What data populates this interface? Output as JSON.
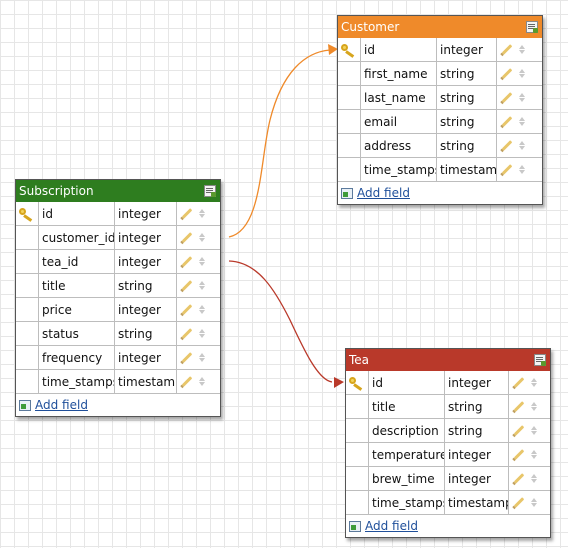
{
  "tables": {
    "customer": {
      "title": "Customer",
      "color": "#ef8a2a",
      "add_label": "Add field",
      "fields": [
        {
          "name": "id",
          "type": "integer",
          "key": true
        },
        {
          "name": "first_name",
          "type": "string"
        },
        {
          "name": "last_name",
          "type": "string"
        },
        {
          "name": "email",
          "type": "string"
        },
        {
          "name": "address",
          "type": "string"
        },
        {
          "name": "time_stamps",
          "type": "timestamp"
        }
      ]
    },
    "subscription": {
      "title": "Subscription",
      "color": "#2e7d1f",
      "add_label": "Add field",
      "fields": [
        {
          "name": "id",
          "type": "integer",
          "key": true
        },
        {
          "name": "customer_id",
          "type": "integer"
        },
        {
          "name": "tea_id",
          "type": "integer"
        },
        {
          "name": "title",
          "type": "string"
        },
        {
          "name": "price",
          "type": "integer"
        },
        {
          "name": "status",
          "type": "string"
        },
        {
          "name": "frequency",
          "type": "integer"
        },
        {
          "name": "time_stamps",
          "type": "timestamp"
        }
      ]
    },
    "tea": {
      "title": "Tea",
      "color": "#b9392a",
      "add_label": "Add field",
      "fields": [
        {
          "name": "id",
          "type": "integer",
          "key": true
        },
        {
          "name": "title",
          "type": "string"
        },
        {
          "name": "description",
          "type": "string"
        },
        {
          "name": "temperature",
          "type": "integer"
        },
        {
          "name": "brew_time",
          "type": "integer"
        },
        {
          "name": "time_stamps",
          "type": "timestamp"
        }
      ]
    }
  },
  "relations": [
    {
      "from": "subscription.customer_id",
      "to": "customer.id",
      "color": "#ef8a2a"
    },
    {
      "from": "subscription.tea_id",
      "to": "tea.id",
      "color": "#b9392a"
    }
  ],
  "icons": {
    "key": "key-icon",
    "edit": "edit-table-icon",
    "pencil": "pencil-icon",
    "reorder": "reorder-arrows-icon",
    "add": "add-field-icon"
  }
}
